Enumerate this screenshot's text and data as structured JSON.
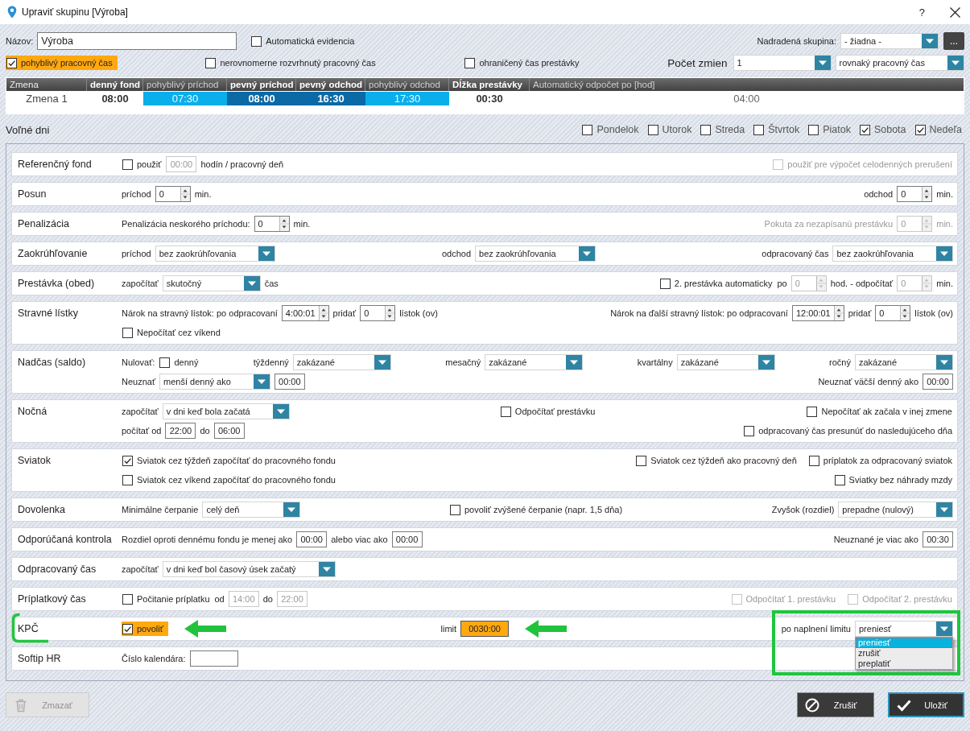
{
  "window": {
    "title": "Upraviť skupinu [Výroba]",
    "help": "?"
  },
  "header": {
    "rows": [
      {
        "groups": [
          {
            "items": [
              {
                "kind": "text",
                "text": "Názov:",
                "disabled": false
              },
              {
                "kind": "input",
                "value": "Výroba"
              },
              {
                "kind": "check",
                "label": "Automatická evidencia",
                "checked": false,
                "disabled": false,
                "highlighted": false
              }
            ]
          },
          {
            "items": [
              {
                "kind": "text",
                "text": "Nadradená skupina:",
                "disabled": false
              },
              {
                "kind": "combo",
                "value": "- žiadna -",
                "expanded": false
              },
              {
                "kind": "button",
                "label": "..."
              }
            ]
          }
        ]
      },
      {
        "groups": [
          {
            "items": [
              {
                "kind": "check",
                "label": "pohyblivý pracovný čas",
                "checked": true,
                "disabled": false,
                "highlighted": true
              }
            ]
          },
          {
            "items": [
              {
                "kind": "check",
                "label": "nerovnomerne rozvrhnutý pracovný čas",
                "checked": false,
                "disabled": false,
                "highlighted": false
              }
            ]
          },
          {
            "items": [
              {
                "kind": "check",
                "label": "ohraničený čas prestávky",
                "checked": false,
                "disabled": false,
                "highlighted": false
              }
            ]
          },
          {
            "items": [
              {
                "kind": "caption",
                "text": "Počet zmien"
              },
              {
                "kind": "combo",
                "value": "1",
                "expanded": false
              },
              {
                "kind": "combo",
                "value": "rovnaký pracovný čas",
                "expanded": false
              }
            ]
          }
        ]
      }
    ]
  },
  "shift_table": {
    "columns": [
      {
        "label": "Zmena",
        "kind": "name"
      },
      {
        "label": "denný fond",
        "kind": "total"
      },
      {
        "label": "pohyblivý príchod",
        "kind": "flexible"
      },
      {
        "label": "pevný príchod",
        "kind": "core"
      },
      {
        "label": "pevný odchod",
        "kind": "core"
      },
      {
        "label": "pohyblivý odchod",
        "kind": "flexible"
      },
      {
        "label": "Dĺžka prestávky",
        "kind": "break"
      },
      {
        "label": "Automatický odpočet po [hod]",
        "kind": "auto"
      }
    ],
    "rows": [
      {
        "cells": [
          "Zmena 1",
          "08:00",
          "07:30",
          "08:00",
          "16:30",
          "17:30",
          "00:30",
          "04:00"
        ]
      }
    ]
  },
  "free_days": {
    "label": "Voľné dni",
    "days": [
      {
        "label": "Pondelok",
        "checked": false
      },
      {
        "label": "Utorok",
        "checked": false
      },
      {
        "label": "Streda",
        "checked": false
      },
      {
        "label": "Štvrtok",
        "checked": false
      },
      {
        "label": "Piatok",
        "checked": false
      },
      {
        "label": "Sobota",
        "checked": true
      },
      {
        "label": "Nedeľa",
        "checked": true
      }
    ]
  },
  "sections": [
    {
      "title": "Referenčný fond",
      "lines": [
        {
          "groups": [
            {
              "items": [
                {
                  "kind": "check",
                  "label": "použiť",
                  "checked": false,
                  "disabled": false,
                  "highlighted": false
                },
                {
                  "kind": "time",
                  "value": "00:00",
                  "disabled": true,
                  "highlighted": false
                },
                {
                  "kind": "text",
                  "text": "hodín / pracovný deň",
                  "disabled": false
                }
              ]
            },
            {
              "items": [
                {
                  "kind": "check",
                  "label": "použiť pre výpočet celodenných prerušení",
                  "checked": false,
                  "disabled": true,
                  "highlighted": false
                }
              ]
            }
          ]
        }
      ]
    },
    {
      "title": "Posun",
      "lines": [
        {
          "groups": [
            {
              "items": [
                {
                  "kind": "text",
                  "text": "príchod",
                  "disabled": false
                },
                {
                  "kind": "spin",
                  "value": "0",
                  "disabled": false
                },
                {
                  "kind": "text",
                  "text": "min.",
                  "disabled": false
                }
              ]
            },
            {
              "items": [
                {
                  "kind": "text",
                  "text": "odchod",
                  "disabled": false
                },
                {
                  "kind": "spin",
                  "value": "0",
                  "disabled": false
                },
                {
                  "kind": "text",
                  "text": "min.",
                  "disabled": false
                }
              ]
            }
          ]
        }
      ]
    },
    {
      "title": "Penalizácia",
      "lines": [
        {
          "groups": [
            {
              "items": [
                {
                  "kind": "text",
                  "text": "Penalizácia neskorého príchodu:",
                  "disabled": false
                },
                {
                  "kind": "spin",
                  "value": "0",
                  "disabled": false
                },
                {
                  "kind": "text",
                  "text": "min.",
                  "disabled": false
                }
              ]
            },
            {
              "items": [
                {
                  "kind": "text",
                  "text": "Pokuta za nezapísanú prestávku",
                  "disabled": true
                },
                {
                  "kind": "spin",
                  "value": "0",
                  "disabled": true
                },
                {
                  "kind": "text",
                  "text": "min.",
                  "disabled": true
                }
              ]
            }
          ]
        }
      ]
    },
    {
      "title": "Zaokrúhľovanie",
      "lines": [
        {
          "groups": [
            {
              "items": [
                {
                  "kind": "text",
                  "text": "príchod",
                  "disabled": false
                },
                {
                  "kind": "combo",
                  "value": "bez zaokrúhľovania",
                  "expanded": false
                }
              ]
            },
            {
              "items": [
                {
                  "kind": "text",
                  "text": "odchod",
                  "disabled": false
                },
                {
                  "kind": "combo",
                  "value": "bez zaokrúhľovania",
                  "expanded": false
                }
              ]
            },
            {
              "items": [
                {
                  "kind": "text",
                  "text": "odpracovaný čas",
                  "disabled": false
                },
                {
                  "kind": "combo",
                  "value": "bez zaokrúhľovania",
                  "expanded": false
                }
              ]
            }
          ]
        }
      ]
    },
    {
      "title": "Prestávka (obed)",
      "lines": [
        {
          "groups": [
            {
              "items": [
                {
                  "kind": "text",
                  "text": "započítať",
                  "disabled": false
                },
                {
                  "kind": "combo",
                  "value": "skutočný",
                  "expanded": false
                },
                {
                  "kind": "text",
                  "text": "čas",
                  "disabled": false
                }
              ]
            },
            {
              "items": [
                {
                  "kind": "check",
                  "label": "2. prestávka automaticky",
                  "checked": false,
                  "disabled": false,
                  "highlighted": false
                },
                {
                  "kind": "text",
                  "text": "po",
                  "disabled": false
                },
                {
                  "kind": "spin",
                  "value": "0",
                  "disabled": true
                },
                {
                  "kind": "text",
                  "text": "hod. - odpočítať",
                  "disabled": false
                },
                {
                  "kind": "spin",
                  "value": "0",
                  "disabled": true
                },
                {
                  "kind": "text",
                  "text": "min.",
                  "disabled": false
                }
              ]
            }
          ]
        }
      ]
    },
    {
      "title": "Stravné lístky",
      "lines": [
        {
          "groups": [
            {
              "items": [
                {
                  "kind": "text",
                  "text": "Nárok na stravný lístok: po odpracovaní",
                  "disabled": false
                },
                {
                  "kind": "spin",
                  "value": "4:00:01",
                  "disabled": false
                },
                {
                  "kind": "text",
                  "text": "pridať",
                  "disabled": false
                },
                {
                  "kind": "spin",
                  "value": "0",
                  "disabled": false
                },
                {
                  "kind": "text",
                  "text": "lístok (ov)",
                  "disabled": false
                }
              ]
            },
            {
              "items": [
                {
                  "kind": "text",
                  "text": "Nárok na ďalší stravný lístok: po odpracovaní",
                  "disabled": false
                },
                {
                  "kind": "spin",
                  "value": "12:00:01",
                  "disabled": false
                },
                {
                  "kind": "text",
                  "text": "pridať",
                  "disabled": false
                },
                {
                  "kind": "spin",
                  "value": "0",
                  "disabled": false
                },
                {
                  "kind": "text",
                  "text": "lístok (ov)",
                  "disabled": false
                }
              ]
            }
          ]
        },
        {
          "groups": [
            {
              "items": [
                {
                  "kind": "check",
                  "label": "Nepočítať cez víkend",
                  "checked": false,
                  "disabled": false,
                  "highlighted": false
                }
              ]
            }
          ]
        }
      ]
    },
    {
      "title": "Nadčas (saldo)",
      "lines": [
        {
          "groups": [
            {
              "items": [
                {
                  "kind": "text",
                  "text": "Nulovať:",
                  "disabled": false
                },
                {
                  "kind": "check",
                  "label": "denný",
                  "checked": false,
                  "disabled": false,
                  "highlighted": false
                }
              ]
            },
            {
              "items": [
                {
                  "kind": "text",
                  "text": "týždenný",
                  "disabled": false
                },
                {
                  "kind": "combo",
                  "value": "zakázané",
                  "expanded": false
                }
              ]
            },
            {
              "items": [
                {
                  "kind": "text",
                  "text": "mesačný",
                  "disabled": false
                },
                {
                  "kind": "combo",
                  "value": "zakázané",
                  "expanded": false
                }
              ]
            },
            {
              "items": [
                {
                  "kind": "text",
                  "text": "kvartálny",
                  "disabled": false
                },
                {
                  "kind": "combo",
                  "value": "zakázané",
                  "expanded": false
                }
              ]
            },
            {
              "items": [
                {
                  "kind": "text",
                  "text": "ročný",
                  "disabled": false
                },
                {
                  "kind": "combo",
                  "value": "zakázané",
                  "expanded": false
                }
              ]
            }
          ]
        },
        {
          "groups": [
            {
              "items": [
                {
                  "kind": "text",
                  "text": "Neuznať",
                  "disabled": false
                },
                {
                  "kind": "combo",
                  "value": "menší denný ako",
                  "expanded": false
                },
                {
                  "kind": "time",
                  "value": "00:00",
                  "disabled": false,
                  "highlighted": false
                }
              ]
            },
            {
              "items": [
                {
                  "kind": "text",
                  "text": "Neuznať väčší denný ako",
                  "disabled": false
                },
                {
                  "kind": "time",
                  "value": "00:00",
                  "disabled": false,
                  "highlighted": false
                }
              ]
            }
          ]
        }
      ]
    },
    {
      "title": "Nočná",
      "lines": [
        {
          "groups": [
            {
              "items": [
                {
                  "kind": "text",
                  "text": "započítať",
                  "disabled": false
                },
                {
                  "kind": "combo",
                  "value": "v dni keď bola začatá",
                  "expanded": false
                }
              ]
            },
            {
              "items": [
                {
                  "kind": "check",
                  "label": "Odpočítať prestávku",
                  "checked": false,
                  "disabled": false,
                  "highlighted": false
                }
              ]
            },
            {
              "items": [
                {
                  "kind": "check",
                  "label": "Nepočítať ak začala v inej zmene",
                  "checked": false,
                  "disabled": false,
                  "highlighted": false
                }
              ]
            }
          ]
        },
        {
          "groups": [
            {
              "items": [
                {
                  "kind": "text",
                  "text": "počítať od",
                  "disabled": false
                },
                {
                  "kind": "time",
                  "value": "22:00",
                  "disabled": false,
                  "highlighted": false
                },
                {
                  "kind": "text",
                  "text": "do",
                  "disabled": false
                },
                {
                  "kind": "time",
                  "value": "06:00",
                  "disabled": false,
                  "highlighted": false
                }
              ]
            },
            {
              "items": [
                {
                  "kind": "check",
                  "label": "odpracovaný čas presunúť do nasledujúceho dňa",
                  "checked": false,
                  "disabled": false,
                  "highlighted": false
                }
              ]
            }
          ]
        }
      ]
    },
    {
      "title": "Sviatok",
      "lines": [
        {
          "groups": [
            {
              "items": [
                {
                  "kind": "check",
                  "label": "Sviatok cez týždeň započítať do pracovného fondu",
                  "checked": true,
                  "disabled": false,
                  "highlighted": false
                }
              ]
            },
            {
              "items": [
                {
                  "kind": "check",
                  "label": "Sviatok cez týždeň ako pracovný deň",
                  "checked": false,
                  "disabled": false,
                  "highlighted": false
                },
                {
                  "kind": "check",
                  "label": "príplatok za odpracovaný sviatok",
                  "checked": false,
                  "disabled": false,
                  "highlighted": false
                }
              ]
            }
          ]
        },
        {
          "groups": [
            {
              "items": [
                {
                  "kind": "check",
                  "label": "Sviatok cez víkend započítať do pracovného fondu",
                  "checked": false,
                  "disabled": false,
                  "highlighted": false
                }
              ]
            },
            {
              "items": [
                {
                  "kind": "check",
                  "label": "Sviatky bez náhrady mzdy",
                  "checked": false,
                  "disabled": false,
                  "highlighted": false
                }
              ]
            }
          ]
        }
      ]
    },
    {
      "title": "Dovolenka",
      "lines": [
        {
          "groups": [
            {
              "items": [
                {
                  "kind": "text",
                  "text": "Minimálne čerpanie",
                  "disabled": false
                },
                {
                  "kind": "combo",
                  "value": "celý deň",
                  "expanded": false
                }
              ]
            },
            {
              "items": [
                {
                  "kind": "check",
                  "label": "povoliť zvýšené čerpanie (napr. 1,5 dňa)",
                  "checked": false,
                  "disabled": false,
                  "highlighted": false
                }
              ]
            },
            {
              "items": [
                {
                  "kind": "text",
                  "text": "Zvyšok (rozdiel)",
                  "disabled": false
                },
                {
                  "kind": "combo",
                  "value": "prepadne (nulový)",
                  "expanded": false
                }
              ]
            }
          ]
        }
      ]
    },
    {
      "title": "Odporúčaná kontrola",
      "lines": [
        {
          "groups": [
            {
              "items": [
                {
                  "kind": "text",
                  "text": "Rozdiel oproti dennému fondu je menej ako",
                  "disabled": false
                },
                {
                  "kind": "time",
                  "value": "00:00",
                  "disabled": false,
                  "highlighted": false
                },
                {
                  "kind": "text",
                  "text": "alebo viac ako",
                  "disabled": false
                },
                {
                  "kind": "time",
                  "value": "00:00",
                  "disabled": false,
                  "highlighted": false
                }
              ]
            },
            {
              "items": [
                {
                  "kind": "text",
                  "text": "Neuznané je viac ako",
                  "disabled": false
                },
                {
                  "kind": "time",
                  "value": "00:30",
                  "disabled": false,
                  "highlighted": false
                }
              ]
            }
          ]
        }
      ]
    },
    {
      "title": "Odpracovaný čas",
      "lines": [
        {
          "groups": [
            {
              "items": [
                {
                  "kind": "text",
                  "text": "započítať",
                  "disabled": false
                },
                {
                  "kind": "combo",
                  "value": "v dni keď bol časový úsek začatý",
                  "expanded": false
                }
              ]
            }
          ]
        }
      ]
    },
    {
      "title": "Príplatkový čas",
      "lines": [
        {
          "groups": [
            {
              "items": [
                {
                  "kind": "check",
                  "label": "Počitanie príplatku",
                  "checked": false,
                  "disabled": false,
                  "highlighted": false
                },
                {
                  "kind": "text",
                  "text": "od",
                  "disabled": false
                },
                {
                  "kind": "time",
                  "value": "14:00",
                  "disabled": true,
                  "highlighted": false
                },
                {
                  "kind": "text",
                  "text": "do",
                  "disabled": false
                },
                {
                  "kind": "time",
                  "value": "22:00",
                  "disabled": true,
                  "highlighted": false
                }
              ]
            },
            {
              "items": [
                {
                  "kind": "check",
                  "label": "Odpočítať 1. prestávku",
                  "checked": false,
                  "disabled": true,
                  "highlighted": false
                },
                {
                  "kind": "check",
                  "label": "Odpočítať 2. prestávku",
                  "checked": false,
                  "disabled": true,
                  "highlighted": false
                }
              ]
            }
          ]
        }
      ]
    },
    {
      "title": "KPČ",
      "bracketed": true,
      "lines": [
        {
          "groups": [
            {
              "items": [
                {
                  "kind": "check",
                  "label": "povoliť",
                  "checked": true,
                  "disabled": false,
                  "highlighted": true
                },
                {
                  "kind": "arrow"
                }
              ]
            },
            {
              "items": [
                {
                  "kind": "text",
                  "text": "limit",
                  "disabled": false
                },
                {
                  "kind": "time",
                  "value": "0030:00",
                  "disabled": false,
                  "highlighted": true
                },
                {
                  "kind": "arrow"
                }
              ]
            },
            {
              "framed": true,
              "items": [
                {
                  "kind": "text",
                  "text": "po naplnení limitu",
                  "disabled": false
                },
                {
                  "kind": "combo",
                  "value": "preniesť",
                  "expanded": true,
                  "options": [
                    {
                      "label": "preniesť",
                      "selected": true
                    },
                    {
                      "label": "zrušiť",
                      "selected": false
                    },
                    {
                      "label": "preplatiť",
                      "selected": false
                    }
                  ]
                }
              ]
            }
          ]
        }
      ]
    },
    {
      "title": "Softip HR",
      "lines": [
        {
          "groups": [
            {
              "items": [
                {
                  "kind": "text",
                  "text": "Číslo kalendára:",
                  "disabled": false
                },
                {
                  "kind": "input"
                }
              ]
            }
          ]
        }
      ]
    }
  ],
  "buttons": [
    {
      "kind": "delete",
      "label": "Zmazať",
      "disabled": true
    },
    {
      "kind": "cancel",
      "label": "Zrušiť",
      "disabled": false
    },
    {
      "kind": "save",
      "label": "Uložiť",
      "disabled": false
    }
  ]
}
